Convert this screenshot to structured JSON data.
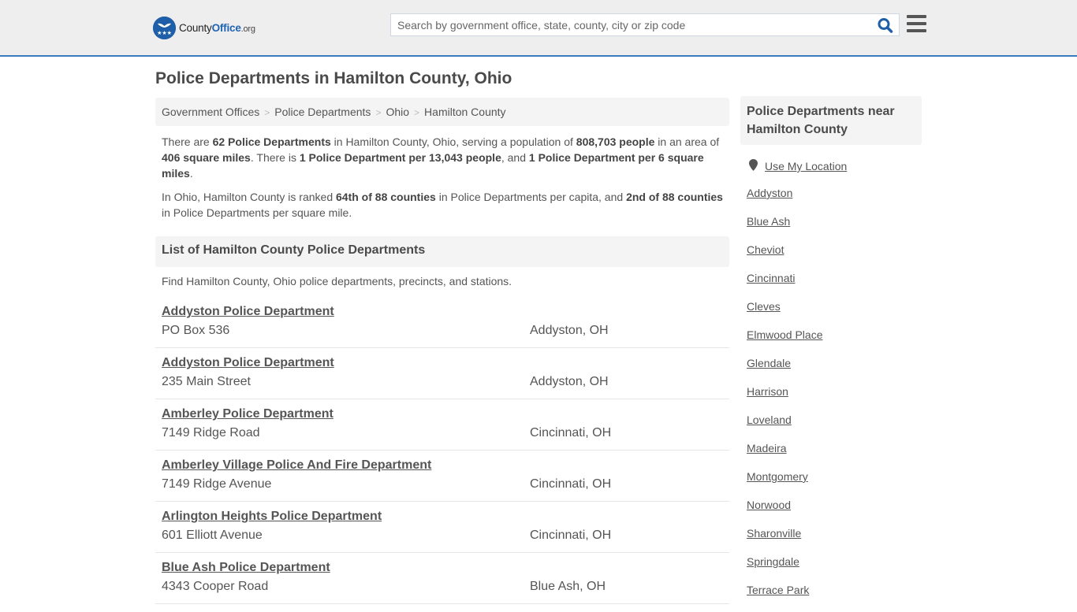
{
  "header": {
    "logo": {
      "prefix": "County",
      "highlight": "Office",
      "suffix": ".org"
    },
    "search_placeholder": "Search by government office, state, county, city or zip code",
    "accent_color": "#3a7bbf"
  },
  "page_title": "Police Departments in Hamilton County, Ohio",
  "breadcrumb": [
    "Government Offices",
    "Police Departments",
    "Ohio",
    "Hamilton County"
  ],
  "intro": {
    "p1": {
      "t1": "There are ",
      "b1": "62 Police Departments",
      "t2": " in Hamilton County, Ohio, serving a population of ",
      "b2": "808,703 people",
      "t3": " in an area of ",
      "b3": "406 square miles",
      "t4": ". There is ",
      "b4": "1 Police Department per 13,043 people",
      "t5": ", and ",
      "b5": "1 Police Department per 6 square miles",
      "t6": "."
    },
    "p2": {
      "t1": "In Ohio, Hamilton County is ranked ",
      "b1": "64th of 88 counties",
      "t2": " in Police Departments per capita, and ",
      "b2": "2nd of 88 counties",
      "t3": " in Police Departments per square mile."
    }
  },
  "list": {
    "heading": "List of Hamilton County Police Departments",
    "description": "Find Hamilton County, Ohio police departments, precincts, and stations.",
    "items": [
      {
        "name": "Addyston Police Department",
        "address": "PO Box 536",
        "city": "Addyston, OH"
      },
      {
        "name": "Addyston Police Department",
        "address": "235 Main Street",
        "city": "Addyston, OH"
      },
      {
        "name": "Amberley Police Department",
        "address": "7149 Ridge Road",
        "city": "Cincinnati, OH"
      },
      {
        "name": "Amberley Village Police And Fire Department",
        "address": "7149 Ridge Avenue",
        "city": "Cincinnati, OH"
      },
      {
        "name": "Arlington Heights Police Department",
        "address": "601 Elliott Avenue",
        "city": "Cincinnati, OH"
      },
      {
        "name": "Blue Ash Police Department",
        "address": "4343 Cooper Road",
        "city": "Blue Ash, OH"
      }
    ]
  },
  "sidebar": {
    "heading": "Police Departments near Hamilton County",
    "use_location": "Use My Location",
    "links": [
      "Addyston",
      "Blue Ash",
      "Cheviot",
      "Cincinnati",
      "Cleves",
      "Elmwood Place",
      "Glendale",
      "Harrison",
      "Loveland",
      "Madeira",
      "Montgomery",
      "Norwood",
      "Sharonville",
      "Springdale",
      "Terrace Park"
    ]
  }
}
